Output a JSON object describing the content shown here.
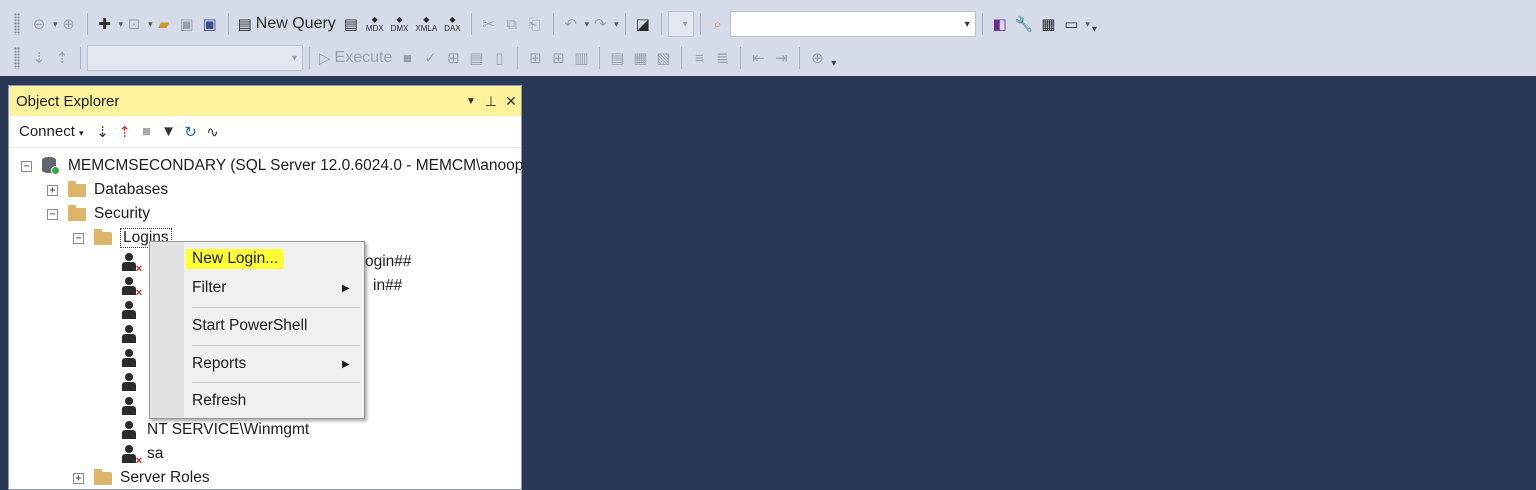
{
  "toolbar": {
    "new_query_label": "New Query",
    "execute_label": "Execute",
    "mdx": "MDX",
    "dmx": "DMX",
    "xmla": "XMLA",
    "dax": "DAX"
  },
  "object_explorer": {
    "title": "Object Explorer",
    "connect_label": "Connect",
    "tree": {
      "server": "MEMCMSECONDARY (SQL Server 12.0.6024.0 - MEMCM\\anoop",
      "databases": "Databases",
      "security": "Security",
      "logins": "Logins",
      "login_frag_1": "ogin##",
      "login_frag_2": "in##",
      "winmgmt": "NT SERVICE\\Winmgmt",
      "sa": "sa",
      "server_roles": "Server Roles"
    }
  },
  "context_menu": {
    "items": [
      {
        "label": "New Login...",
        "highlighted": true
      },
      {
        "label": "Filter",
        "submenu": true
      },
      {
        "label": "Start PowerShell"
      },
      {
        "label": "Reports",
        "submenu": true
      },
      {
        "label": "Refresh"
      }
    ]
  },
  "colors": {
    "background": "#293955",
    "title_bar": "#fff29d",
    "highlight": "#ffff33"
  }
}
